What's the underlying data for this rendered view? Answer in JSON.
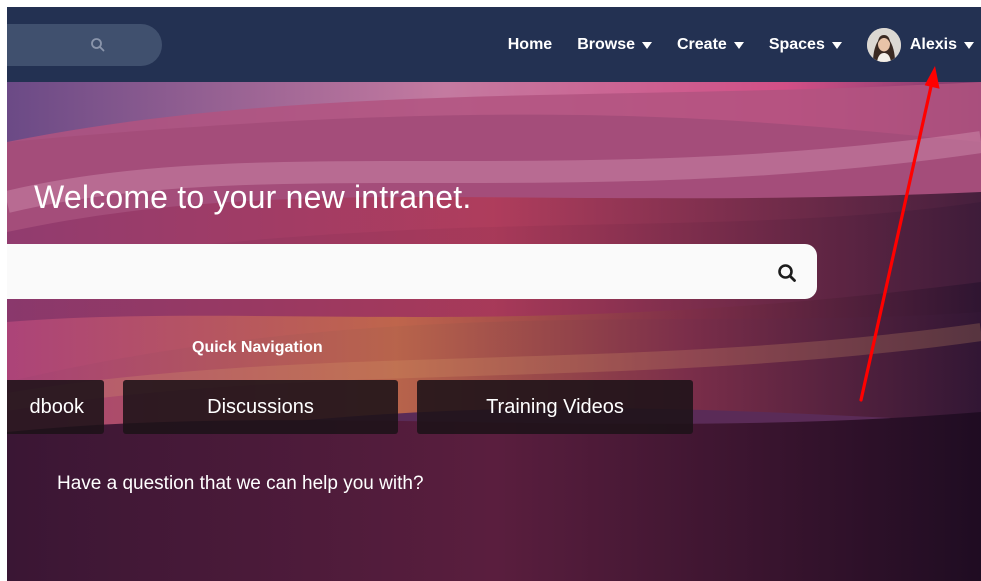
{
  "nav": {
    "links": [
      {
        "label": "Home",
        "has_caret": false
      },
      {
        "label": "Browse",
        "has_caret": true
      },
      {
        "label": "Create",
        "has_caret": true
      },
      {
        "label": "Spaces",
        "has_caret": true
      }
    ],
    "user": {
      "name": "Alexis"
    }
  },
  "hero": {
    "welcome": "Welcome to your new intranet.",
    "search": {
      "value": "",
      "placeholder": ""
    },
    "quick_nav": {
      "title": "Quick Navigation",
      "buttons": [
        {
          "label": "dbook"
        },
        {
          "label": "Discussions"
        },
        {
          "label": "Training Videos"
        }
      ]
    },
    "question": "Have a question that we can help you with?"
  },
  "icons": {
    "nav_search": "search-icon",
    "hero_search": "search-icon",
    "caret": "caret-down-icon",
    "avatar": "user-avatar",
    "annotation": "red-arrow"
  },
  "colors": {
    "navbar": "#233152",
    "nav_search": "#40506e",
    "annotation_arrow": "#ff0000"
  }
}
